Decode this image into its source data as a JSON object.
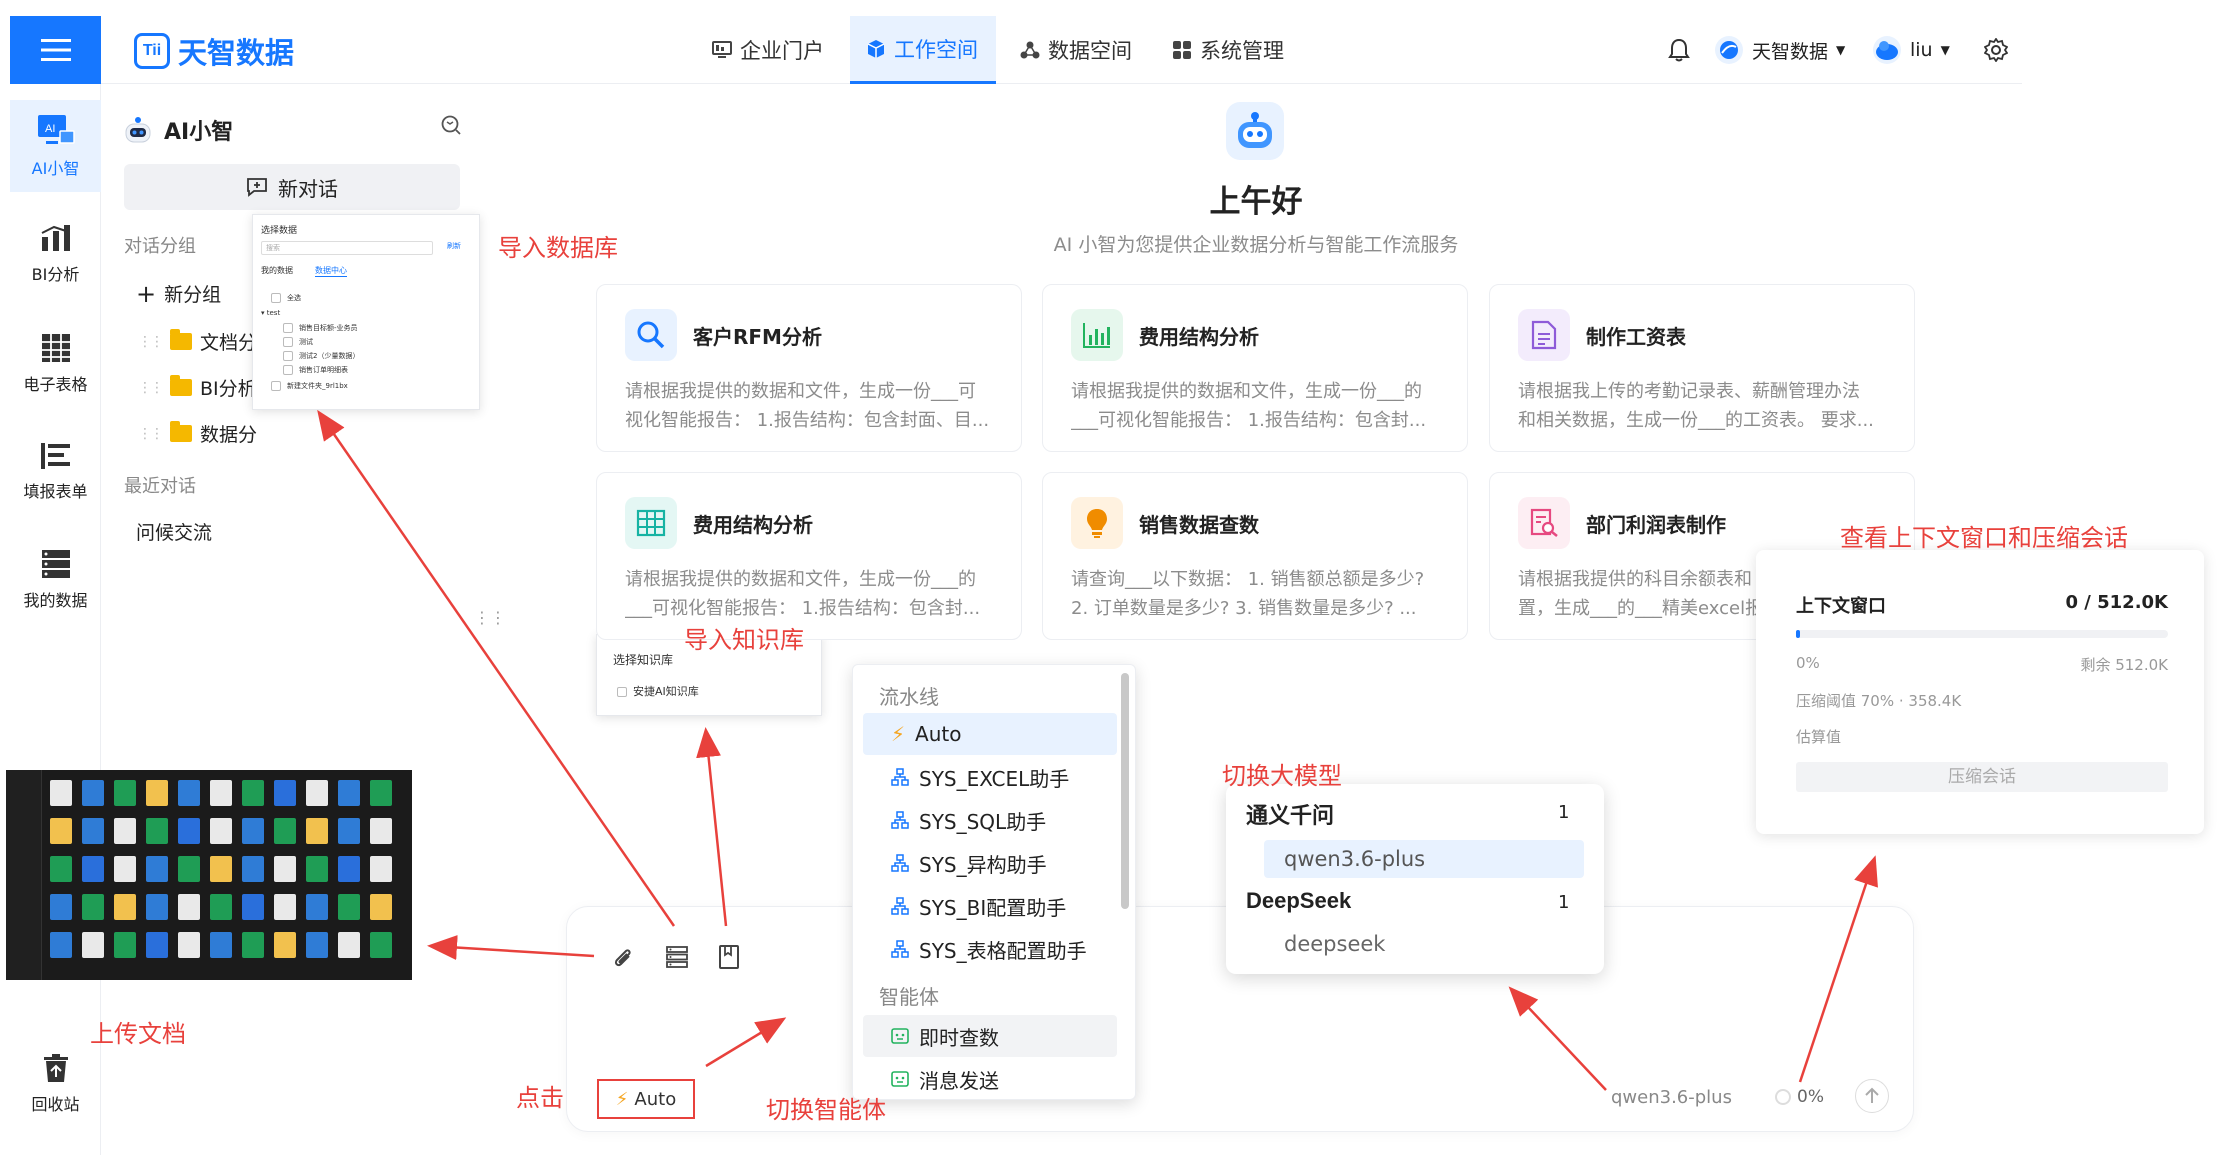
{
  "header": {
    "logo_mark": "Tii",
    "logo_text": "天智数据",
    "tabs": [
      {
        "label": "企业门户",
        "icon": "monitor-icon"
      },
      {
        "label": "工作空间",
        "icon": "cube-icon",
        "active": true
      },
      {
        "label": "数据空间",
        "icon": "nodes-icon"
      },
      {
        "label": "系统管理",
        "icon": "apps-icon"
      }
    ],
    "org_name": "天智数据",
    "user_name": "liu"
  },
  "leftrail": {
    "items": [
      {
        "label": "AI小智",
        "icon": "ai-assistant-icon",
        "active": true
      },
      {
        "label": "BI分析",
        "icon": "bar-chart-icon"
      },
      {
        "label": "电子表格",
        "icon": "spreadsheet-icon"
      },
      {
        "label": "填报表单",
        "icon": "form-icon"
      },
      {
        "label": "我的数据",
        "icon": "database-icon"
      }
    ],
    "recycle_label": "回收站"
  },
  "conv_panel": {
    "title": "AI小智",
    "new_chat_label": "新对话",
    "group_label": "对话分组",
    "new_group_label": "新分组",
    "groups": [
      "文档分",
      "BI分析",
      "数据分"
    ],
    "recent_label": "最近对话",
    "recent": [
      "问候交流"
    ]
  },
  "db_popup": {
    "title": "选择数据",
    "search_placeholder": "搜索",
    "refresh_label": "刷新",
    "tabs": [
      "我的数据",
      "数据中心"
    ],
    "select_all": "全选",
    "folder": "test",
    "items": [
      "销售目标额-业务员",
      "测试",
      "测试2（少量数据）",
      "销售订单明细表"
    ],
    "new_folder": "新建文件夹_9rl1bx"
  },
  "kb_popup": {
    "title": "选择知识库",
    "item": "安捷AI知识库"
  },
  "main": {
    "greeting": "上午好",
    "subtitle": "AI 小智为您提供企业数据分析与智能工作流服务",
    "cards": [
      {
        "title": "客户RFM分析",
        "icon": "search-icon",
        "color": "#1677ff",
        "bg": "#e8f2ff",
        "line1": "请根据我提供的数据和文件，生成一份___可",
        "line2": "视化智能报告： 1.报告结构：包含封面、目..."
      },
      {
        "title": "费用结构分析",
        "icon": "bar-chart-icon",
        "color": "#22b35e",
        "bg": "#e6f7ed",
        "line1": "请根据我提供的数据和文件，生成一份___的",
        "line2": "___可视化智能报告： 1.报告结构：包含封..."
      },
      {
        "title": "制作工资表",
        "icon": "document-icon",
        "color": "#8e5bd8",
        "bg": "#f3ecfc",
        "line1": "请根据我上传的考勤记录表、薪酬管理办法",
        "line2": "和相关数据，生成一份___的工资表。 要求..."
      },
      {
        "title": "费用结构分析",
        "icon": "table-icon",
        "color": "#17b3a3",
        "bg": "#e4f7f4",
        "line1": "请根据我提供的数据和文件，生成一份___的",
        "line2": "___可视化智能报告： 1.报告结构：包含封..."
      },
      {
        "title": "销售数据查数",
        "icon": "lightbulb-icon",
        "color": "#f08c00",
        "bg": "#fff2e0",
        "line1": "请查询___以下数据： 1. 销售额总额是多少?",
        "line2": "2. 订单数量是多少? 3. 销售数量是多少? ..."
      },
      {
        "title": "部门利润表制作",
        "icon": "report-search-icon",
        "color": "#e64980",
        "bg": "#fdeef3",
        "line1": "请根据我提供的科目余额表和",
        "line2": "置，生成___的___精美excel报"
      }
    ]
  },
  "agent_dropdown": {
    "pipeline_label": "流水线",
    "pipelines": [
      "Auto",
      "SYS_EXCEL助手",
      "SYS_SQL助手",
      "SYS_异构助手",
      "SYS_BI配置助手",
      "SYS_表格配置助手"
    ],
    "agents_label": "智能体",
    "agents": [
      "即时查数",
      "消息发送"
    ]
  },
  "model_dropdown": {
    "groups": [
      {
        "name": "通义千问",
        "count": "1",
        "models": [
          "qwen3.6-plus"
        ]
      },
      {
        "name": "DeepSeek",
        "count": "1",
        "models": [
          "deepseek"
        ]
      }
    ]
  },
  "context_panel": {
    "title": "上下文窗口",
    "usage": "0 / 512.0K",
    "used_pct_label": "0%",
    "remaining": "剩余 512.0K",
    "threshold": "压缩阈值 70% · 358.4K",
    "estimate": "估算值",
    "compress_button": "压缩会话",
    "progress": 0.01
  },
  "input": {
    "auto_label": "Auto",
    "model_label": "qwen3.6-plus",
    "ctx_pct": "0%"
  },
  "annotations": {
    "import_db": "导入数据库",
    "import_kb": "导入知识库",
    "upload_doc": "上传文档",
    "click": "点击",
    "switch_agent": "切换智能体",
    "switch_model": "切换大模型",
    "view_context": "查看上下文窗口和压缩会话"
  },
  "colors": {
    "primary": "#1677ff",
    "annotation": "#e8413c"
  }
}
